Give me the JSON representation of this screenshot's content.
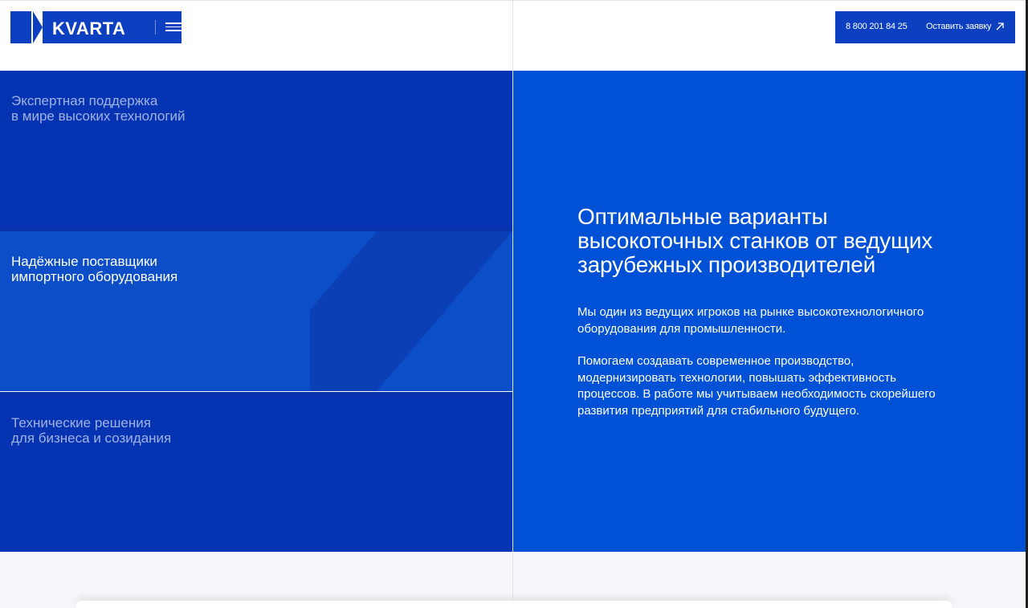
{
  "header": {
    "logo_text": "KVARTA",
    "menu_icon": "hamburger-icon",
    "phone": "8 800 201 84 25",
    "apply_label": "Оставить заявку",
    "apply_icon": "arrow-up-right-icon"
  },
  "left_menu": {
    "items": [
      {
        "line1": "Экспертная поддержка",
        "line2": "в мире высоких технологий",
        "active": false
      },
      {
        "line1": "Надёжные поставщики",
        "line2": "импортного оборудования",
        "active": true
      },
      {
        "line1": "Технические решения",
        "line2": "для бизнеса и созидания",
        "active": false
      }
    ]
  },
  "content": {
    "title_line1": "Оптимальные варианты",
    "title_line2": "высокоточных станков от ведущих",
    "title_line3": "зарубежных производителей",
    "para1_line1": "Мы один из ведущих игроков на рынке высокотехнологичного",
    "para1_line2": "оборудования для промышленности.",
    "para2_line1": "Помогаем создавать современное производство,",
    "para2_line2": "модернизировать технологии, повышать эффективность",
    "para2_line3": "процессов. В работе мы учитываем необходимость скорейшего",
    "para2_line4": "развития предприятий для стабильного будущего."
  },
  "colors": {
    "brand_blue": "#0d3fc1",
    "panel_blue": "#0051d5",
    "dark_blue": "#0533b1",
    "active_blue": "#0c4ec8"
  }
}
